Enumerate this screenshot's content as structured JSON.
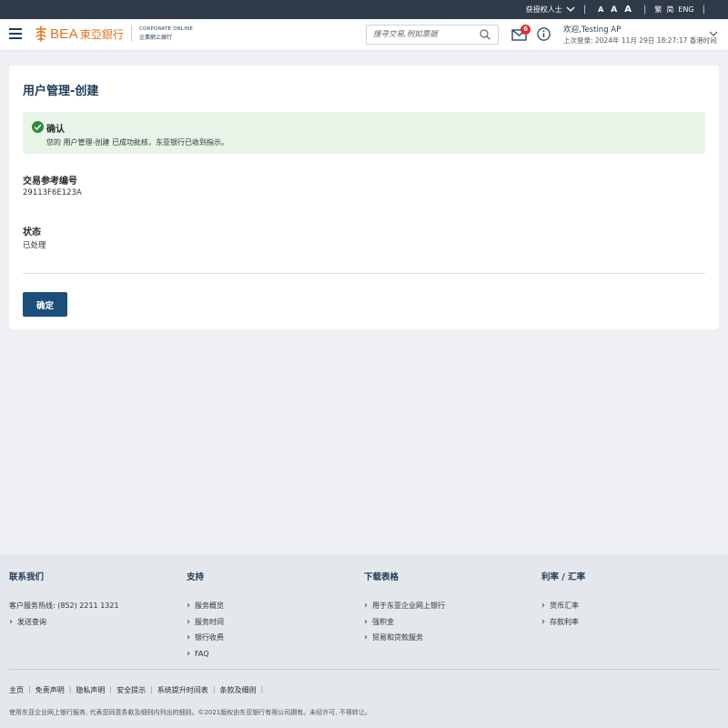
{
  "utility_bar": {
    "audience": "获授权人士",
    "font_sizes": [
      "A",
      "A",
      "A"
    ],
    "lang_tc": "繁",
    "lang_sc": "简",
    "lang_en": "ENG"
  },
  "header": {
    "brand_en": "BEA",
    "brand_cn": "東亞銀行",
    "product_en": "CORPORATE ONLINE",
    "product_cn": "企業網上銀行",
    "search_placeholder": "搜寻交易,例如票据",
    "mail_badge": "6",
    "welcome": "欢迎,Testing AP",
    "last_login": "上次登录: 2024年 11月 29日 18:27:17 香港时间"
  },
  "main": {
    "title": "用户管理-创建",
    "alert_title": "确认",
    "alert_message": "您的 用户管理-创建 已成功批核，东亚银行已收到指示。",
    "ref_label": "交易参考编号",
    "ref_value": "29113F6E123A",
    "status_label": "状态",
    "status_value": "已处理",
    "confirm_button": "确定"
  },
  "footer": {
    "contact": {
      "title": "联系我们",
      "hotline": "客户服务热线: (852) 2211 1321",
      "links": [
        "发送查询"
      ]
    },
    "support": {
      "title": "支持",
      "links": [
        "服务概览",
        "服务时间",
        "银行收费",
        "FAQ"
      ]
    },
    "downloads": {
      "title": "下载表格",
      "links": [
        "用于东亚企业网上银行",
        "强积金",
        "贸易和贷款服务"
      ]
    },
    "rates": {
      "title": "利率 / 汇率",
      "links": [
        "货币汇率",
        "存款利率"
      ]
    },
    "legal_links": [
      "主页",
      "免责声明",
      "隐私声明",
      "安全提示",
      "系统提升时间表",
      "条款及细则"
    ],
    "copyright": "使用东亚企业网上银行服务, 代表您同意条款及细则内列出的细则。©2021版权由东亚银行有限公司拥有。未经许可, 不得转让。"
  }
}
